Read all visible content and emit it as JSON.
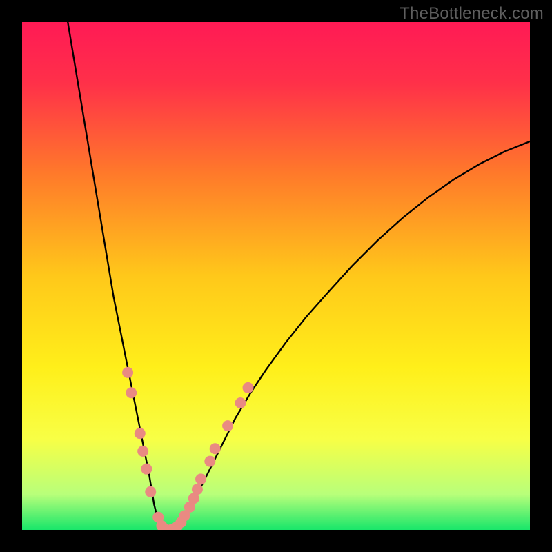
{
  "watermark": "TheBottleneck.com",
  "chart_data": {
    "type": "line",
    "title": "",
    "xlabel": "",
    "ylabel": "",
    "xlim": [
      0,
      100
    ],
    "ylim": [
      0,
      100
    ],
    "grid": false,
    "background_gradient": {
      "stops": [
        {
          "offset": 0.0,
          "color": "#ff1a55"
        },
        {
          "offset": 0.12,
          "color": "#ff3049"
        },
        {
          "offset": 0.3,
          "color": "#ff7a2a"
        },
        {
          "offset": 0.5,
          "color": "#ffc81a"
        },
        {
          "offset": 0.68,
          "color": "#ffef1a"
        },
        {
          "offset": 0.82,
          "color": "#f8ff45"
        },
        {
          "offset": 0.93,
          "color": "#b8ff7a"
        },
        {
          "offset": 1.0,
          "color": "#18e66a"
        }
      ]
    },
    "series": [
      {
        "name": "bottleneck-curve",
        "color": "#000000",
        "x": [
          9,
          10,
          11,
          12,
          13,
          14,
          15,
          16,
          17,
          18,
          19,
          20,
          21,
          22,
          23,
          24,
          25,
          25.5,
          26,
          26.5,
          27,
          27.5,
          28,
          29,
          30,
          31,
          32,
          34,
          36,
          38,
          40,
          42,
          45,
          48,
          52,
          56,
          60,
          65,
          70,
          75,
          80,
          85,
          90,
          95,
          100
        ],
        "y": [
          100,
          94,
          88,
          82,
          76,
          70,
          64,
          58,
          52,
          46,
          41,
          36,
          31,
          26,
          21,
          16,
          11,
          8,
          5,
          3,
          1.5,
          0.7,
          0.2,
          0.0,
          0.3,
          1.2,
          2.6,
          6.0,
          10.0,
          14.0,
          18.0,
          22.0,
          27.0,
          31.5,
          37.0,
          42.0,
          46.5,
          52.0,
          57.0,
          61.5,
          65.5,
          69.0,
          72.0,
          74.5,
          76.5
        ]
      }
    ],
    "points": {
      "name": "highlight-points",
      "color": "#e98a82",
      "radius": 8,
      "xy": [
        [
          20.8,
          31.0
        ],
        [
          21.5,
          27.0
        ],
        [
          23.2,
          19.0
        ],
        [
          23.8,
          15.5
        ],
        [
          24.5,
          12.0
        ],
        [
          25.3,
          7.5
        ],
        [
          26.8,
          2.5
        ],
        [
          27.5,
          0.8
        ],
        [
          28.5,
          0.0
        ],
        [
          29.5,
          0.1
        ],
        [
          30.5,
          0.6
        ],
        [
          31.3,
          1.5
        ],
        [
          32.0,
          2.8
        ],
        [
          33.0,
          4.5
        ],
        [
          33.8,
          6.2
        ],
        [
          34.5,
          8.0
        ],
        [
          35.2,
          10.0
        ],
        [
          37.0,
          13.5
        ],
        [
          38.0,
          16.0
        ],
        [
          40.5,
          20.5
        ],
        [
          43.0,
          25.0
        ],
        [
          44.5,
          28.0
        ]
      ]
    }
  }
}
